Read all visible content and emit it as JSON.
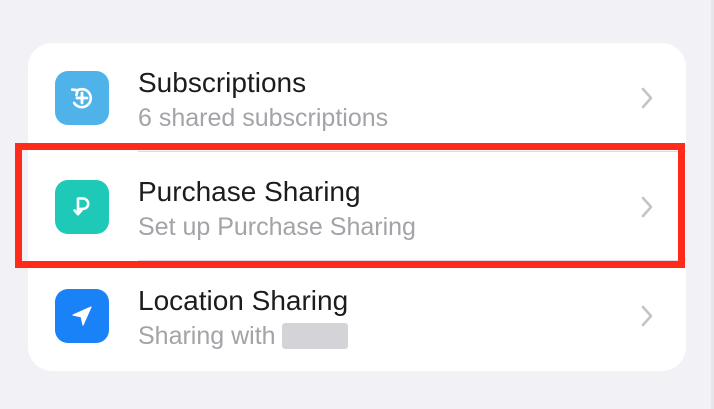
{
  "settings_list": {
    "items": [
      {
        "title": "Subscriptions",
        "subtitle": "6 shared subscriptions",
        "icon": "subscriptions-icon",
        "icon_color": "#4fb3ea"
      },
      {
        "title": "Purchase Sharing",
        "subtitle": "Set up Purchase Sharing",
        "icon": "purchase-sharing-icon",
        "icon_color": "#1ec9b7"
      },
      {
        "title": "Location Sharing",
        "subtitle": "Sharing with",
        "icon": "location-arrow-icon",
        "icon_color": "#1a82f7"
      }
    ]
  },
  "colors": {
    "background": "#f2f1f6",
    "card": "#ffffff",
    "highlight": "#ff2a1a",
    "secondary_text": "#a3a3a8"
  }
}
